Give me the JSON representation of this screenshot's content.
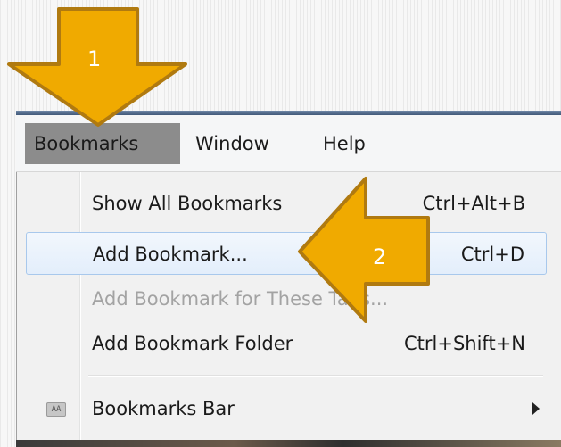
{
  "menubar": {
    "items": [
      {
        "label": "Bookmarks",
        "active": true
      },
      {
        "label": "Window",
        "active": false
      },
      {
        "label": "Help",
        "active": false
      }
    ]
  },
  "dropdown": {
    "items": [
      {
        "label": "Show All Bookmarks",
        "shortcut": "Ctrl+Alt+B",
        "state": "normal"
      },
      {
        "label": "Add Bookmark...",
        "shortcut": "Ctrl+D",
        "state": "hover"
      },
      {
        "label": "Add Bookmark for These Tabs...",
        "shortcut": "",
        "state": "disabled"
      },
      {
        "label": "Add Bookmark Folder",
        "shortcut": "Ctrl+Shift+N",
        "state": "normal"
      },
      {
        "label": "Bookmarks Bar",
        "shortcut": "",
        "state": "normal",
        "icon": "bookmarks-bar-icon",
        "icon_text": "AA",
        "submenu": true
      }
    ]
  },
  "annotations": {
    "callout1": "1",
    "callout2": "2",
    "arrow_color": "#f0aa00",
    "arrow_border": "#b07a10"
  }
}
